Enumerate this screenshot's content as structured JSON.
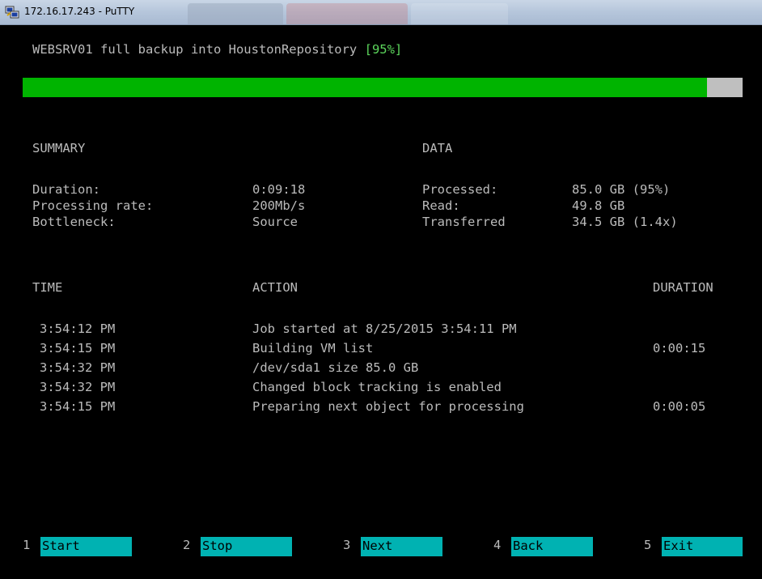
{
  "window": {
    "title": "172.16.17.243 - PuTTY"
  },
  "job": {
    "header_prefix": "WEBSRV01 full backup into HoustonRepository ",
    "header_percent": "[95%]",
    "progress": 0.95
  },
  "summary": {
    "heading": "SUMMARY",
    "rows": [
      {
        "label": "Duration:",
        "value": "0:09:18"
      },
      {
        "label": "Processing rate:",
        "value": "200Mb/s"
      },
      {
        "label": "Bottleneck:",
        "value": "Source"
      }
    ]
  },
  "data_section": {
    "heading": "DATA",
    "rows": [
      {
        "label": "Processed:",
        "value": "85.0 GB (95%)"
      },
      {
        "label": "Read:",
        "value": "49.8 GB"
      },
      {
        "label": "Transferred",
        "value": "34.5 GB (1.4x)"
      }
    ]
  },
  "log": {
    "headers": {
      "time": "TIME",
      "action": "ACTION",
      "duration": "DURATION"
    },
    "rows": [
      {
        "time": "3:54:12 PM",
        "action": "Job started at 8/25/2015 3:54:11 PM",
        "duration": ""
      },
      {
        "time": "3:54:15 PM",
        "action": "Building VM list",
        "duration": "0:00:15"
      },
      {
        "time": "3:54:32 PM",
        "action": "/dev/sda1 size 85.0 GB",
        "duration": ""
      },
      {
        "time": "3:54:32 PM",
        "action": "Changed block tracking is enabled",
        "duration": ""
      },
      {
        "time": "3:54:15 PM",
        "action": "Preparing next object for processing",
        "duration": "0:00:05"
      }
    ]
  },
  "function_keys": [
    {
      "num": "1",
      "label": "Start"
    },
    {
      "num": "2",
      "label": "Stop"
    },
    {
      "num": "3",
      "label": "Next"
    },
    {
      "num": "4",
      "label": "Back"
    },
    {
      "num": "5",
      "label": "Exit"
    }
  ],
  "colors": {
    "progress_fill": "#00b400",
    "progress_track": "#bfbfbf",
    "fkey_background": "#00b2b2",
    "percent_text": "#5cd65c"
  },
  "icons": {
    "title": "putty-icon"
  }
}
